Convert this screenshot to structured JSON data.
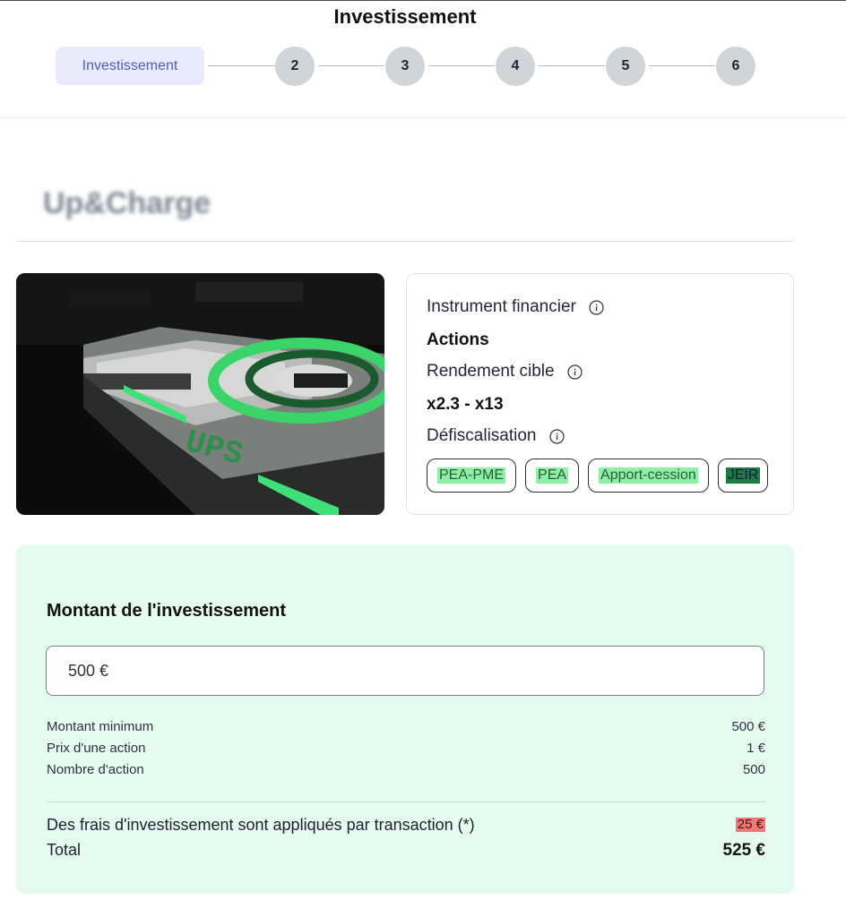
{
  "header": {
    "title": "Investissement",
    "stepper": {
      "active_label": "Investissement",
      "steps": [
        "2",
        "3",
        "4",
        "5",
        "6"
      ]
    }
  },
  "project": {
    "logo_text": "Up&Charge",
    "image_text": "UPS"
  },
  "info": {
    "instrument_label": "Instrument financier",
    "instrument_value": "Actions",
    "rendement_label": "Rendement cible",
    "rendement_value": "x2.3 - x13",
    "defisc_label": "Défiscalisation",
    "tags": [
      "PEA-PME",
      "PEA",
      "Apport-cession",
      "JEIR"
    ]
  },
  "investment": {
    "title": "Montant de l'investissement",
    "amount_value": "500 €",
    "details": [
      {
        "label": "Montant minimum",
        "value": "500 €"
      },
      {
        "label": "Prix d'une action",
        "value": "1 €"
      },
      {
        "label": "Nombre d'action",
        "value": "500"
      }
    ],
    "fee_label": "Des frais d'investissement sont appliqués par transaction (*)",
    "fee_value": "25 €",
    "total_label": "Total",
    "total_value": "525 €"
  },
  "colors": {
    "accent": "#4d5cc2",
    "panel_bg": "#e6fbef",
    "tag_highlight": "#8ef0a6",
    "fee_highlight": "#ee7a78"
  }
}
